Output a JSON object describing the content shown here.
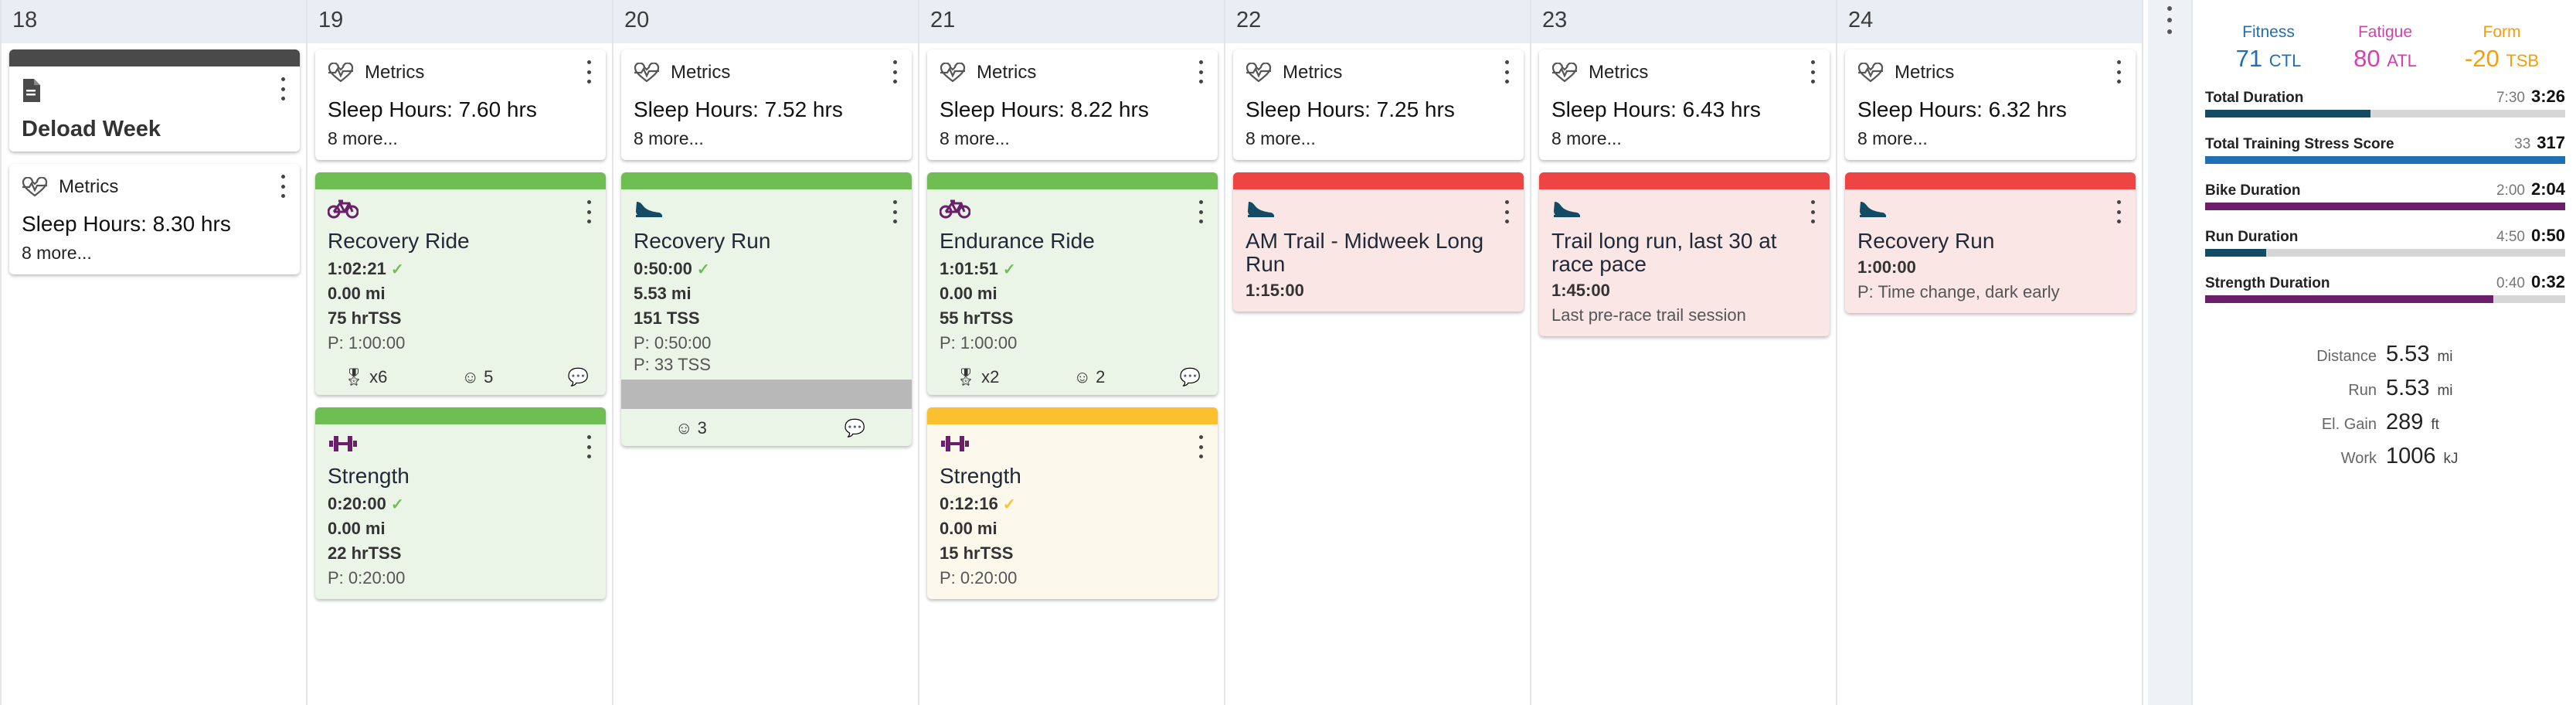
{
  "colors": {
    "green": "#6fbe54",
    "red": "#ef4444",
    "yellow": "#fbc02d",
    "dark": "#4a4a4a",
    "bike": "#6b1f6b",
    "run": "#124b63",
    "fitness": "#1f6fb5",
    "fatigue": "#d63fb0",
    "form": "#f59e0b"
  },
  "days": [
    {
      "num": "18",
      "note": {
        "title": "Deload Week",
        "icon": "document-icon"
      },
      "metrics": {
        "label": "Metrics",
        "sleep": "Sleep Hours: 8.30 hrs",
        "more": "8 more..."
      }
    },
    {
      "num": "19",
      "metrics": {
        "label": "Metrics",
        "sleep": "Sleep Hours: 7.60 hrs",
        "more": "8 more..."
      },
      "workouts": [
        {
          "icon": "bike-icon",
          "title": "Recovery Ride",
          "duration": "1:02:21",
          "distance": "0.00 mi",
          "tss": "75 hrTSS",
          "plan": "P: 1:00:00",
          "foot": {
            "medals": "x6",
            "smiles": "5"
          }
        },
        {
          "icon": "dumbbell-icon",
          "title": "Strength",
          "duration": "0:20:00",
          "distance": "0.00 mi",
          "tss": "22 hrTSS",
          "plan": "P: 0:20:00"
        }
      ]
    },
    {
      "num": "20",
      "metrics": {
        "label": "Metrics",
        "sleep": "Sleep Hours: 7.52 hrs",
        "more": "8 more..."
      },
      "workouts": [
        {
          "icon": "shoe-icon",
          "title": "Recovery Run",
          "duration": "0:50:00",
          "distance": "5.53 mi",
          "tss": "151 TSS",
          "plan": "P: 0:50:00",
          "plan2": "P: 33 TSS",
          "foot": {
            "smiles": "3"
          }
        }
      ]
    },
    {
      "num": "21",
      "metrics": {
        "label": "Metrics",
        "sleep": "Sleep Hours: 8.22 hrs",
        "more": "8 more..."
      },
      "workouts": [
        {
          "icon": "bike-icon",
          "title": "Endurance Ride",
          "duration": "1:01:51",
          "distance": "0.00 mi",
          "tss": "55 hrTSS",
          "plan": "P: 1:00:00",
          "foot": {
            "medals": "x2",
            "smiles": "2"
          }
        },
        {
          "icon": "dumbbell-icon",
          "title": "Strength",
          "duration": "0:12:16",
          "distance": "0.00 mi",
          "tss": "15 hrTSS",
          "plan": "P: 0:20:00"
        }
      ]
    },
    {
      "num": "22",
      "metrics": {
        "label": "Metrics",
        "sleep": "Sleep Hours: 7.25 hrs",
        "more": "8 more..."
      },
      "workouts": [
        {
          "icon": "shoe-icon",
          "title": "AM Trail - Midweek Long Run",
          "duration": "1:15:00"
        }
      ]
    },
    {
      "num": "23",
      "metrics": {
        "label": "Metrics",
        "sleep": "Sleep Hours: 6.43 hrs",
        "more": "8 more..."
      },
      "workouts": [
        {
          "icon": "shoe-icon",
          "title": "Trail long run, last 30 at race pace",
          "duration": "1:45:00",
          "desc": "Last pre-race trail session"
        }
      ]
    },
    {
      "num": "24",
      "metrics": {
        "label": "Metrics",
        "sleep": "Sleep Hours: 6.32 hrs",
        "more": "8 more..."
      },
      "workouts": [
        {
          "icon": "shoe-icon",
          "title": "Recovery Run",
          "duration": "1:00:00",
          "desc": "P: Time change, dark early"
        }
      ]
    }
  ],
  "summary": {
    "fitness": {
      "label": "Fitness",
      "value": "71",
      "unit": "CTL"
    },
    "fatigue": {
      "label": "Fatigue",
      "value": "80",
      "unit": "ATL"
    },
    "form": {
      "label": "Form",
      "value": "-20",
      "unit": "TSB"
    },
    "bars": [
      {
        "name": "Total Duration",
        "planned": "7:30",
        "actual": "3:26",
        "progress": 0.46,
        "color": "#124b63"
      },
      {
        "name": "Total Training Stress Score",
        "planned": "33",
        "actual": "317",
        "progress": 1.0,
        "color": "#1f6fb5"
      },
      {
        "name": "Bike Duration",
        "planned": "2:00",
        "actual": "2:04",
        "progress": 1.0,
        "color": "#6b1f6b"
      },
      {
        "name": "Run Duration",
        "planned": "4:50",
        "actual": "0:50",
        "progress": 0.17,
        "color": "#124b63"
      },
      {
        "name": "Strength Duration",
        "planned": "0:40",
        "actual": "0:32",
        "progress": 0.8,
        "color": "#6b1f6b"
      }
    ],
    "totals": [
      {
        "label": "Distance",
        "value": "5.53",
        "unit": "mi"
      },
      {
        "label": "Run",
        "value": "5.53",
        "unit": "mi"
      },
      {
        "label": "El. Gain",
        "value": "289",
        "unit": "ft"
      },
      {
        "label": "Work",
        "value": "1006",
        "unit": "kJ"
      }
    ]
  }
}
